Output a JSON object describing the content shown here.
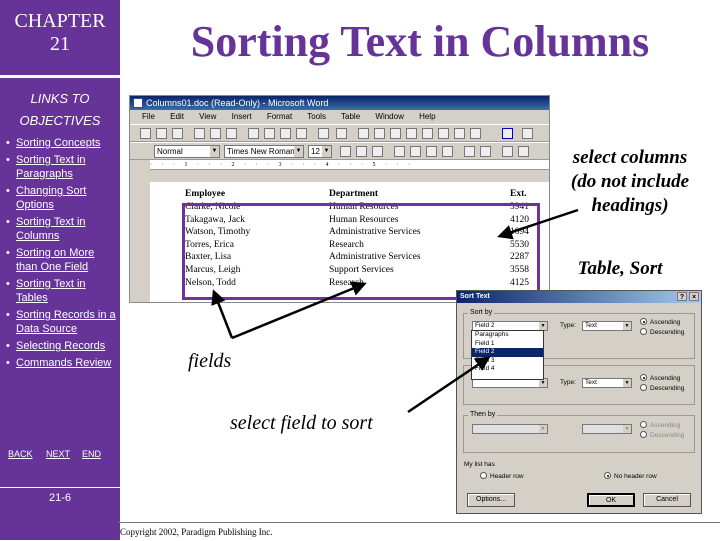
{
  "sidebar": {
    "chapter_label": "CHAPTER",
    "chapter_number": "21",
    "links_title_line1": "LINKS TO",
    "links_title_line2": "OBJECTIVES",
    "objectives": [
      "Sorting Concepts",
      "Sorting Text in Paragraphs",
      "Changing Sort Options",
      "Sorting Text in Columns",
      "Sorting on More than One Field",
      "Sorting Text in Tables",
      "Sorting Records in a Data Source",
      "Selecting Records",
      "Commands Review"
    ],
    "nav": {
      "back": "BACK",
      "next": "NEXT",
      "end": "END"
    },
    "page_number": "21-6",
    "background_color": "#663399"
  },
  "title": "Sorting Text in Columns",
  "title_color": "#663399",
  "word_window": {
    "title": "Columns01.doc (Read-Only) - Microsoft Word",
    "menu": [
      "File",
      "Edit",
      "View",
      "Insert",
      "Format",
      "Tools",
      "Table",
      "Window",
      "Help"
    ],
    "style_box": "Normal",
    "font_box": "Times New Roman",
    "size_box": "12",
    "ruler": "· · · 1 · · · 2 · · · 3 · · · 4 · · · 5 · · ·",
    "table_headers": [
      "Employee",
      "Department",
      "Ext."
    ],
    "rows": [
      [
        "Clarke, Nicole",
        "Human Resources",
        "3941"
      ],
      [
        "Takagawa, Jack",
        "Human Resources",
        "4120"
      ],
      [
        "Watson, Timothy",
        "Administrative Services",
        "1094"
      ],
      [
        "Torres, Erica",
        "Research",
        "5530"
      ],
      [
        "Baxter, Lisa",
        "Administrative Services",
        "2287"
      ],
      [
        "Marcus, Leigh",
        "Support Services",
        "3558"
      ],
      [
        "Nelson, Todd",
        "Research",
        "4125"
      ]
    ]
  },
  "sort_dialog": {
    "title": "Sort Text",
    "help_button": "?",
    "close_button": "×",
    "sort_by_label": "Sort by",
    "sort_by_value": "Field 2",
    "type_label": "Type:",
    "type_value": "Text",
    "ascending": "Ascending",
    "descending": "Descending",
    "dropdown_options": [
      "Paragraphs",
      "Field 1",
      "Field 2",
      "Field 3",
      "Field 4"
    ],
    "dropdown_selected_index": 2,
    "then_by_label": "Then by",
    "then_by_type_value": "Text",
    "then_by2_label": "Then by",
    "my_list_has": "My list has",
    "header_row": "Header row",
    "no_header_row": "No header row",
    "options_button": "Options...",
    "ok_button": "OK",
    "cancel_button": "Cancel"
  },
  "callouts": {
    "select_columns": [
      "select columns",
      "(do not include",
      "headings)"
    ],
    "table_sort": "Table, Sort",
    "fields": "fields",
    "select_field": "select field to sort"
  },
  "selection_color": "#7030a0",
  "copyright": "Copyright 2002, Paradigm Publishing Inc."
}
